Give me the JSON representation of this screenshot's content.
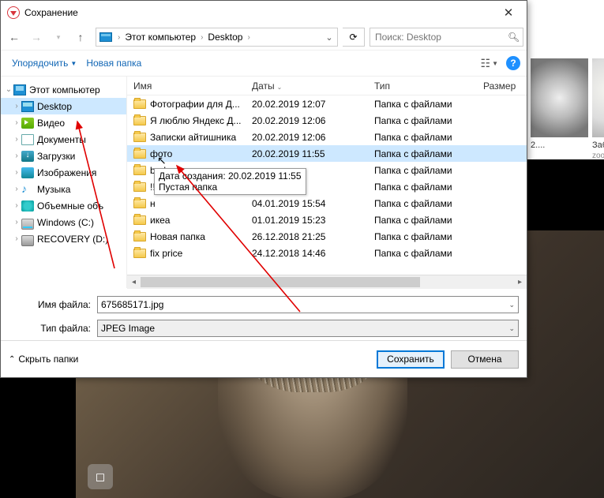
{
  "title": "Сохранение",
  "nav": {
    "crumb_root": "Этот компьютер",
    "crumb_child": "Desktop",
    "search_placeholder": "Поиск: Desktop"
  },
  "toolbar": {
    "organize": "Упорядочить",
    "new_folder": "Новая папка"
  },
  "tree": {
    "root": "Этот компьютер",
    "items": [
      {
        "label": "Desktop",
        "icon": "ic-desktop",
        "selected": true
      },
      {
        "label": "Видео",
        "icon": "ic-video"
      },
      {
        "label": "Документы",
        "icon": "ic-doc"
      },
      {
        "label": "Загрузки",
        "icon": "ic-down"
      },
      {
        "label": "Изображения",
        "icon": "ic-img"
      },
      {
        "label": "Музыка",
        "icon": "ic-music",
        "glyph": "♪"
      },
      {
        "label": "Объемные объ",
        "icon": "ic-3d"
      },
      {
        "label": "Windows (C:)",
        "icon": "ic-drive"
      },
      {
        "label": "RECOVERY (D:)",
        "icon": "ic-rec"
      }
    ]
  },
  "columns": {
    "name": "Имя",
    "date": "Даты",
    "type": "Тип",
    "size": "Размер"
  },
  "rows": [
    {
      "name": "Фотографии для Д...",
      "date": "20.02.2019 12:07",
      "type": "Папка с файлами"
    },
    {
      "name": "Я люблю Яндекс Д...",
      "date": "20.02.2019 12:06",
      "type": "Папка с файлами"
    },
    {
      "name": "Записки айтишника",
      "date": "20.02.2019 12:06",
      "type": "Папка с файлами"
    },
    {
      "name": "фото",
      "date": "20.02.2019 11:55",
      "type": "Папка с файлами",
      "selected": true
    },
    {
      "name": "bed",
      "date": "",
      "type": "Папка с файлами"
    },
    {
      "name": "!!! Д",
      "date": "",
      "type": "Папка с файлами"
    },
    {
      "name": "н",
      "date": "04.01.2019 15:54",
      "type": "Папка с файлами"
    },
    {
      "name": "икеа",
      "date": "01.01.2019 15:23",
      "type": "Папка с файлами"
    },
    {
      "name": "Новая папка",
      "date": "26.12.2018 21:25",
      "type": "Папка с файлами"
    },
    {
      "name": "fix price",
      "date": "24.12.2018 14:46",
      "type": "Папка с файлами"
    }
  ],
  "tooltip": {
    "line1": "Дата создания: 20.02.2019 11:55",
    "line2": "Пустая папка"
  },
  "form": {
    "filename_label": "Имя файла:",
    "filename_value": "675685171.jpg",
    "filetype_label": "Тип файла:",
    "filetype_value": "JPEG Image"
  },
  "footer": {
    "hide": "Скрыть папки",
    "save": "Сохранить",
    "cancel": "Отмена"
  },
  "thumbs": {
    "t1_label": "2....",
    "t2_label": "Забавн",
    "t2_sub": "zooblog"
  }
}
